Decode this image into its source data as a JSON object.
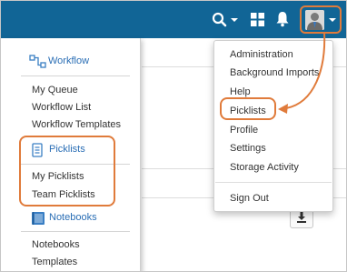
{
  "topbar": {
    "background": "#116596",
    "icons": [
      "search-icon",
      "grid-icon",
      "bell-icon",
      "avatar"
    ]
  },
  "left_menu": {
    "workflow": {
      "header": "Workflow",
      "icon": "workflow-icon",
      "items": [
        "My Queue",
        "Workflow List",
        "Workflow Templates"
      ]
    },
    "picklists": {
      "header": "Picklists",
      "icon": "picklist-icon",
      "items": [
        "My Picklists",
        "Team Picklists"
      ]
    },
    "notebooks": {
      "header": "Notebooks",
      "icon": "notebook-icon",
      "items": [
        "Notebooks",
        "Templates"
      ]
    }
  },
  "user_menu": {
    "items": [
      "Administration",
      "Background Imports",
      "Help",
      "Picklists",
      "Profile",
      "Settings",
      "Storage Activity"
    ],
    "footer_item": "Sign Out"
  },
  "colors": {
    "accent_link": "#2a6eb5",
    "highlight": "#e07b3b"
  }
}
